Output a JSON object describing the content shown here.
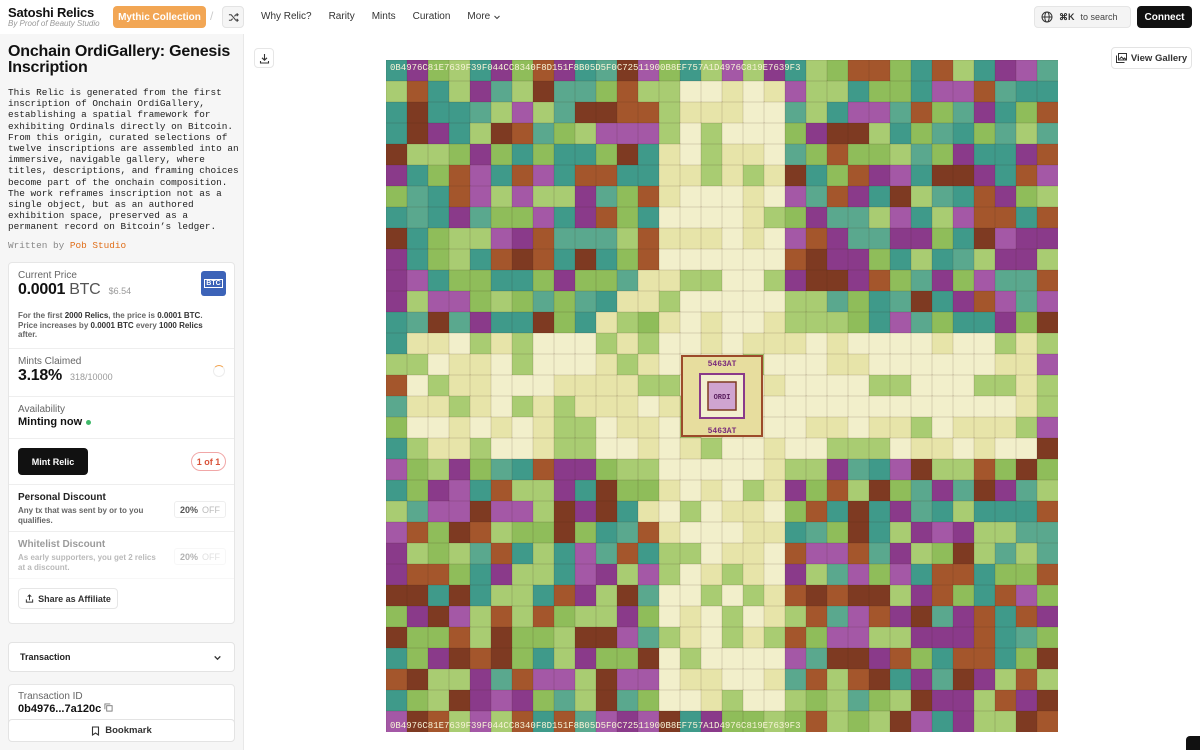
{
  "header": {
    "brand_title": "Satoshi Relics",
    "brand_subtitle": "By Proof of Beauty Studio",
    "collection_button": "Mythic Collection",
    "nav": [
      "Why Relic?",
      "Rarity",
      "Mints",
      "Curation",
      "More"
    ],
    "search_shortcut": "⌘K",
    "search_label": "to search",
    "connect_label": "Connect"
  },
  "relic": {
    "title": "Onchain OrdiGallery: Genesis Inscription",
    "description": "This Relic is generated from the first inscription of Onchain OrdiGallery, establishing a spatial framework for exhibiting Ordinals directly on Bitcoin. From this origin, curated selections of twelve inscriptions are assembled into an immersive, navigable gallery, where titles, descriptions, and framing choices become part of the onchain composition. The work reframes inscription not as a single object, but as an authored exhibition space, preserved as a permanent record on Bitcoin’s ledger.",
    "written_by_label": "Written by",
    "author": "Pob Studio"
  },
  "price": {
    "label": "Current Price",
    "amount": "0.0001",
    "unit": "BTC",
    "usd": "$6.54",
    "badge": "BTC",
    "note_prefix": "For the first",
    "note_count": "2000 Relics",
    "note_mid": ", the price is",
    "note_price": "0.0001 BTC",
    "note_mid2": ". Price increases by",
    "note_increase": "0.0001 BTC",
    "note_mid3": "every",
    "note_step": "1000 Relics",
    "note_suffix": "after."
  },
  "mints": {
    "label": "Mints Claimed",
    "percent": "3.18%",
    "count": "318/10000",
    "progress_fraction": 0.0318
  },
  "availability": {
    "label": "Availability",
    "status": "Minting now",
    "status_color": "#3fb96a"
  },
  "mint": {
    "button": "Mint Relic",
    "quantity": "1 of 1"
  },
  "discounts": [
    {
      "title": "Personal Discount",
      "desc": "Any tx that was sent by or to you qualifies.",
      "percent": "20%",
      "off": "OFF"
    },
    {
      "title": "Whitelist Discount",
      "desc": "As early supporters, you get 2 relics at a discount.",
      "percent": "20%",
      "off": "OFF"
    }
  ],
  "affiliate_button": "Share as Affiliate",
  "transaction": {
    "label": "Transaction",
    "id_label": "Transaction ID",
    "id_value": "0b4976...7a120c"
  },
  "bookmark_label": "Bookmark",
  "gallery_button": "View Gallery",
  "artwork": {
    "center_text": "5463AT",
    "center_word": "ORDI",
    "border_text": "0B4976C81E7639F39F044CC8340F8D151F8B05D5F0C72511900B8EF757A1D4976C819E7639F3",
    "palette": [
      "#8fbd5a",
      "#a9cc72",
      "#5aa88e",
      "#3f9a8a",
      "#8a3a8a",
      "#a458a6",
      "#7e3a22",
      "#a4562c",
      "#f2efcb",
      "#e7e4a9",
      "#c6a84c",
      "#d8bf78"
    ]
  },
  "colors": {
    "accent": "#f2a654",
    "dark_button": "#111111",
    "btc_badge": "#3c63b8"
  }
}
